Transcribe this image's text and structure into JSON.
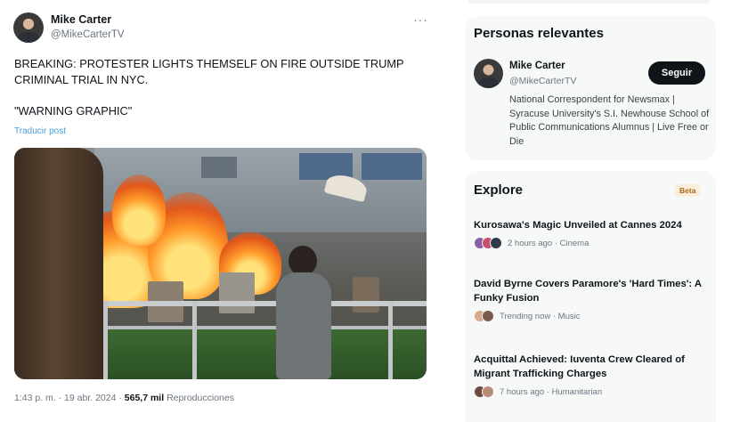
{
  "tweet": {
    "author_name": "Mike Carter",
    "author_handle": "@MikeCarterTV",
    "more_icon": "more-horizontal-icon",
    "text_line1": "BREAKING: PROTESTER LIGHTS THEMSELF ON FIRE OUTSIDE TRUMP CRIMINAL TRIAL IN NYC.",
    "text_line2": "\"WARNING GRAPHIC\"",
    "translate_label": "Traducir post",
    "time": "1:43 p. m.",
    "separator": "·",
    "date": "19 abr. 2024",
    "views": "565,7 mil",
    "views_label": "Reproducciones"
  },
  "sidebar": {
    "people": {
      "title": "Personas relevantes",
      "name": "Mike Carter",
      "handle": "@MikeCarterTV",
      "follow_label": "Seguir",
      "bio": "National Correspondent for Newsmax | Syracuse University's S.I. Newhouse School of Public Communications Alumnus | Live Free or Die"
    },
    "explore": {
      "title": "Explore",
      "badge": "Beta",
      "items": [
        {
          "title": "Kurosawa's Magic Unveiled at Cannes 2024",
          "meta": "2 hours ago · Cinema"
        },
        {
          "title": "David Byrne Covers Paramore's 'Hard Times': A Funky Fusion",
          "meta": "Trending now · Music"
        },
        {
          "title": "Acquittal Achieved: Iuventa Crew Cleared of Migrant Trafficking Charges",
          "meta": "7 hours ago · Humanitarian"
        }
      ]
    }
  },
  "colors": {
    "text": "#0f1419",
    "muted": "#6b7680",
    "link": "#4a9fe0",
    "panel_bg": "#f7f9f9",
    "follow_bg": "#0f1419",
    "beta_bg": "#fbeed8",
    "beta_text": "#a7651a"
  }
}
